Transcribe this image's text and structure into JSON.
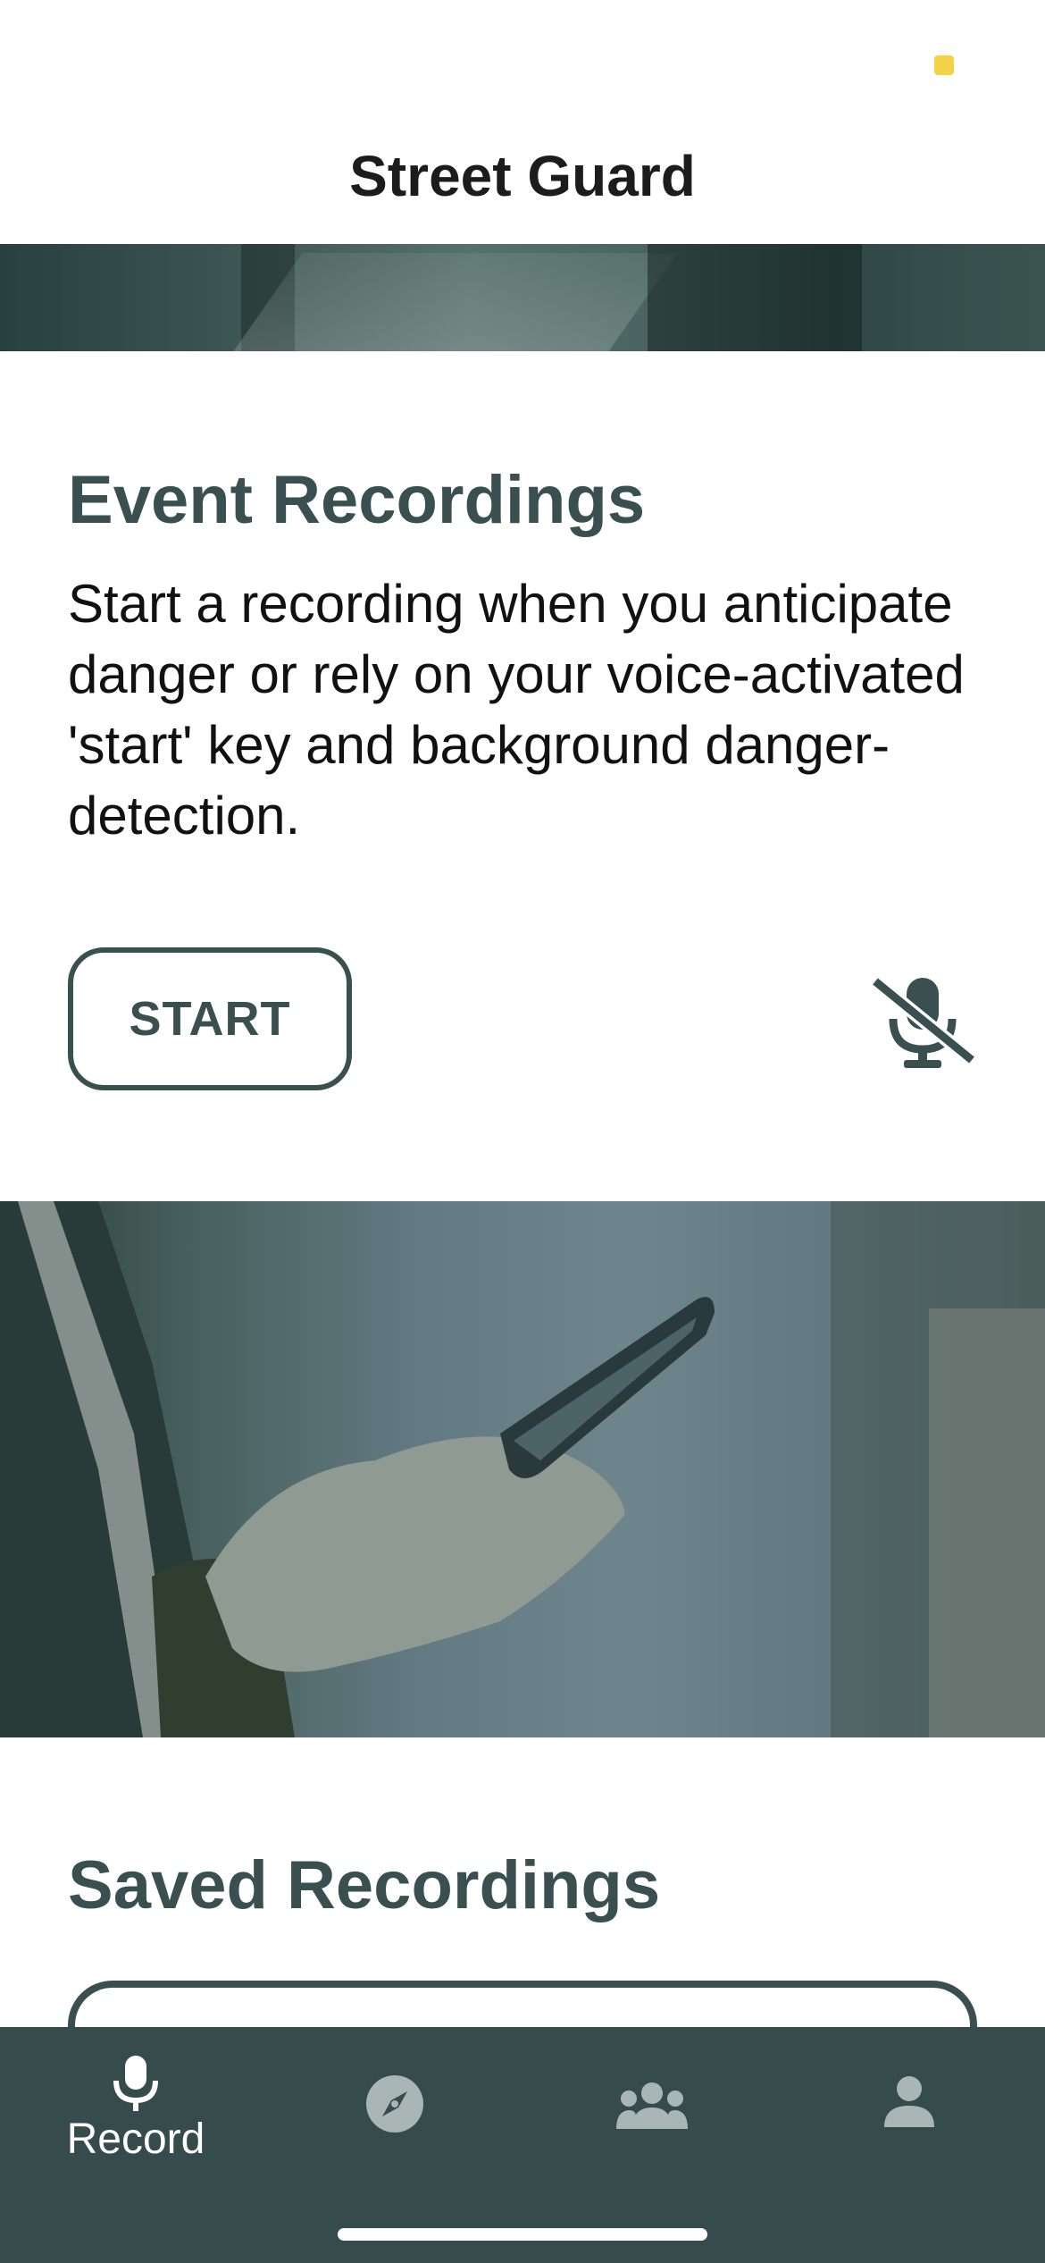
{
  "header": {
    "title": "Street Guard"
  },
  "event_recordings": {
    "title": "Event Recordings",
    "description": "Start a recording when you anticipate danger or rely on your voice-activated 'start' key and background danger-detection.",
    "start_label": "START",
    "mic_icon": "mic-off-icon"
  },
  "saved_recordings": {
    "title": "Saved Recordings"
  },
  "bottom_nav": {
    "items": [
      {
        "label": "Record",
        "icon": "mic-icon",
        "active": true
      },
      {
        "label": "",
        "icon": "compass-icon",
        "active": false
      },
      {
        "label": "",
        "icon": "group-icon",
        "active": false
      },
      {
        "label": "",
        "icon": "person-icon",
        "active": false
      }
    ]
  },
  "colors": {
    "accent": "#3a5050",
    "nav_background": "#364b4b",
    "status_dot": "#f4d24a"
  }
}
